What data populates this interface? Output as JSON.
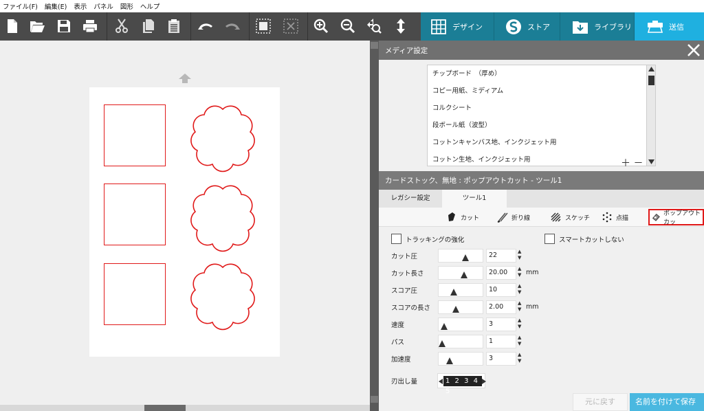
{
  "menu": [
    "ファイル(F)",
    "編集(E)",
    "表示",
    "パネル",
    "図形",
    "ヘルプ"
  ],
  "tabs": [
    {
      "label": "デザイン",
      "icon": "grid-icon"
    },
    {
      "label": "ストア",
      "icon": "store-icon"
    },
    {
      "label": "ライブラリ",
      "icon": "folder-icon"
    },
    {
      "label": "送信",
      "icon": "cutter-icon",
      "active": true
    }
  ],
  "panel": {
    "title": "メディア設定",
    "media_items": [
      "チップボード　（厚め）",
      "コピー用紙、ミディアム",
      "コルクシート",
      "段ボール紙（波型）",
      "コットンキャンバス地、インクジェット用",
      "コットン生地、インクジェット用"
    ],
    "media_controls": "＋ －",
    "selected_media": "カードストック、無地 : ポップアウトカット - ツール1",
    "tool_tabs": [
      "レガシー設定",
      "ツール1"
    ],
    "modes": [
      "カット",
      "折り線",
      "スケッチ",
      "点描",
      "ポップアウトカッ"
    ],
    "tracking_label": "トラッキングの強化",
    "smart_cut_label": "スマートカットしない",
    "settings": [
      {
        "label": "カット圧",
        "value": "22",
        "unit": "",
        "level": 0.6
      },
      {
        "label": "カット長さ",
        "value": "20.00",
        "unit": "mm",
        "level": 0.58
      },
      {
        "label": "スコア圧",
        "value": "10",
        "unit": "",
        "level": 0.3
      },
      {
        "label": "スコアの長さ",
        "value": "2.00",
        "unit": "mm",
        "level": 0.35
      },
      {
        "label": "速度",
        "value": "3",
        "unit": "",
        "level": 0.05
      },
      {
        "label": "パス",
        "value": "1",
        "unit": "",
        "level": 0.0
      },
      {
        "label": "加速度",
        "value": "3",
        "unit": "",
        "level": 0.2
      }
    ],
    "blade_label": "刃出し量",
    "blade_value": "1 2 3 4 5",
    "revert_label": "元に戻す",
    "save_label": "名前を付けて保存"
  },
  "colors": {
    "cut_line": "#e01818",
    "tab_active": "#1fb0e0",
    "highlight": "#e01818"
  }
}
